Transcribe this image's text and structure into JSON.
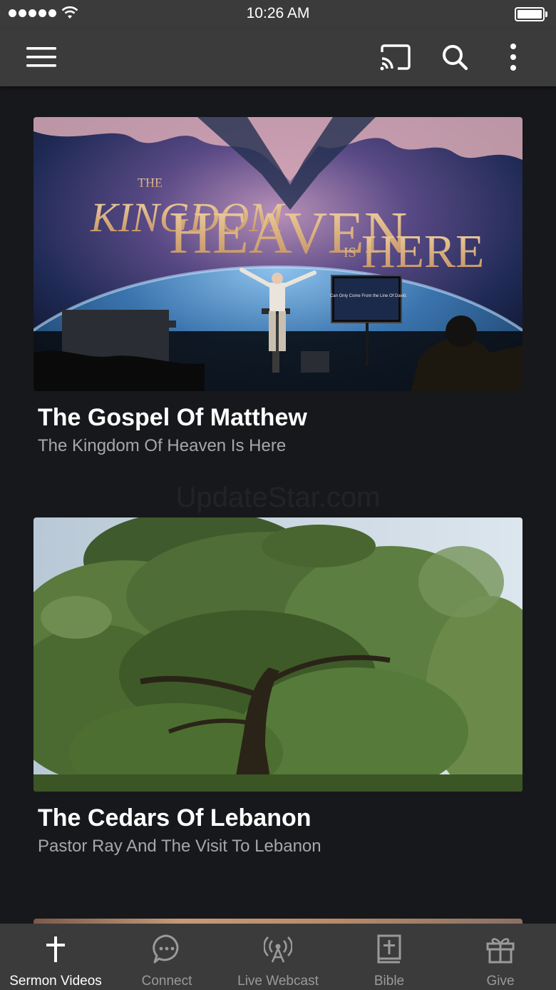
{
  "status_bar": {
    "time": "10:26 AM",
    "signal_icon": "signal-dots-icon",
    "wifi_icon": "wifi-icon",
    "battery_icon": "battery-full-icon",
    "battery_level": 1.0
  },
  "nav_bar": {
    "menu_icon": "hamburger-menu-icon",
    "cast_icon": "cast-icon",
    "search_icon": "search-icon",
    "more_icon": "more-vertical-icon"
  },
  "sermons": [
    {
      "title": "The Gospel Of Matthew",
      "subtitle": "The Kingdom Of Heaven Is Here",
      "thumb_text": {
        "kingdom": "KINGDOM",
        "the": "THE",
        "heaven": "HEAVEN",
        "is": "IS",
        "here": "HERE",
        "screen": "Can Only Come From the Line Of David."
      }
    },
    {
      "title": "The Cedars Of Lebanon",
      "subtitle": "Pastor Ray And The Visit To Lebanon"
    }
  ],
  "watermark": "UpdateStar.com",
  "tabs": [
    {
      "label": "Sermon Videos",
      "icon": "cross-icon",
      "active": true
    },
    {
      "label": "Connect",
      "icon": "chat-bubble-icon",
      "active": false
    },
    {
      "label": "Live Webcast",
      "icon": "broadcast-antenna-icon",
      "active": false
    },
    {
      "label": "Bible",
      "icon": "bible-icon",
      "active": false
    },
    {
      "label": "Give",
      "icon": "gift-icon",
      "active": false
    }
  ],
  "colors": {
    "bar_background": "#3b3b3b",
    "content_background": "#17181b",
    "active_tab": "#ffffff",
    "inactive_tab": "#9a9a9a",
    "subtitle": "#a7a7a7"
  }
}
